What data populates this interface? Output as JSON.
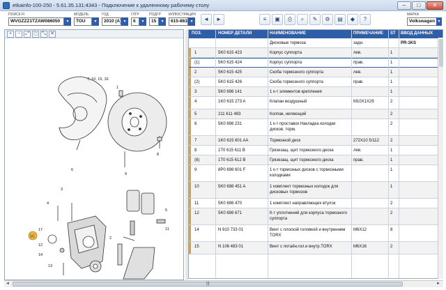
{
  "window": {
    "title": "etkainfo-100-250 - 5.61.35.131:4343 - Подключение к удаленному рабочему столу",
    "min": "–",
    "max": "□",
    "close": "✕"
  },
  "filters": {
    "vin": {
      "label": "ПОИСК FI",
      "value": "WVGZZZ1TZAW086050"
    },
    "model": {
      "label": "МОДЕЛЬ",
      "value": "TOU"
    },
    "year": {
      "label": "ГОД",
      "value": "2010 (A)"
    },
    "group": {
      "label": "ГЛГР",
      "value": "6"
    },
    "subgroup": {
      "label": "ПОДГР",
      "value": "15"
    },
    "illustration": {
      "label": "ИЛЛЮСТРАЦИЯ",
      "value": "615-863"
    },
    "brand": {
      "label": "МАРКА",
      "value": "Volkswagen"
    },
    "drop": "▾"
  },
  "toolbar": [
    "◄",
    "►",
    "≡",
    "▣",
    "⎙",
    "⌕",
    "✎",
    "⚙",
    "▤",
    "◆",
    "?"
  ],
  "zoom": [
    "+",
    "−",
    "⤢",
    "◻",
    "⤡",
    "✕"
  ],
  "diagram": {
    "callouts": [
      "7, 10, 15, 16",
      "1",
      "3",
      "17",
      "12",
      "14",
      "13",
      "1C",
      "2",
      "6",
      "4",
      "5",
      "8",
      "9",
      "11"
    ]
  },
  "table": {
    "headers": [
      "ПОЗ.",
      "НОМЕР ДЕТАЛИ",
      "НАИМЕНОВАНИЕ",
      "ПРИМЕЧАНИЕ",
      "ST",
      "ВВОД ДАННЫХ"
    ],
    "intro_name": "Дисковые тормоза",
    "intro_note": "задн.",
    "intro_data": "PR-1KS",
    "rows": [
      {
        "pos": "1",
        "part": "5K0 615 423",
        "name": "Корпус суппорта",
        "note": "лев.",
        "qty": "1"
      },
      {
        "pos": "(1)",
        "part": "5K0 615 424",
        "name": "Корпус суппорта",
        "note": "прав.",
        "qty": "1"
      },
      {
        "pos": "2",
        "part": "5K0 615 425",
        "name": "Скоба тормозного суппорта",
        "note": "лев.",
        "qty": "1"
      },
      {
        "pos": "(2)",
        "part": "5K0 615 426",
        "name": "Скоба тормозного суппорта",
        "note": "прав.",
        "qty": "1"
      },
      {
        "pos": "3",
        "part": "5K0 698 141",
        "name": "1 к-т элементов крепления",
        "note": "",
        "qty": "1"
      },
      {
        "pos": "4",
        "part": "1K0 615 273 A",
        "name": "Клапан воздушный",
        "note": "M10X1X29",
        "qty": "2"
      },
      {
        "pos": "5",
        "part": "211 611 483",
        "name": "Колпак, нелеющий",
        "note": "",
        "qty": "2"
      },
      {
        "pos": "6",
        "part": "5K0 698 231",
        "name": "1 к-т проставок Накладка колодки дисков. торм.",
        "note": "",
        "qty": "2"
      },
      {
        "pos": "7",
        "part": "1K0 615 601 AA",
        "name": "Тормозной диск",
        "note": "272X10  5/112",
        "qty": "2"
      },
      {
        "pos": "8",
        "part": "1T0 615 611 B",
        "name": "Грязезащ. щит тормозного диска",
        "note": "лев.",
        "qty": "1"
      },
      {
        "pos": "(8)",
        "part": "1T0 615 612 B",
        "name": "Грязезащ. щит тормозного диска",
        "note": "прав.",
        "qty": "1"
      },
      {
        "pos": "9",
        "part": "8P0 698 601 F",
        "name": "1 к-т тормозных дисков с тормозными колодками",
        "note": "",
        "qty": "1"
      },
      {
        "pos": "10",
        "part": "5K0 698 451 A",
        "name": "1 комплект тормозных колодок для дисковых тормозов",
        "note": "",
        "qty": "1"
      },
      {
        "pos": "11",
        "part": "5K0 698 470",
        "name": "1 комплект направляющих втулок",
        "note": "",
        "qty": "2"
      },
      {
        "pos": "12",
        "part": "5K0 698 671",
        "name": "К-т уплотнений для корпуса тормозного суппорта",
        "note": "",
        "qty": "2"
      },
      {
        "pos": "14",
        "part": "N   910 733 01",
        "name": "Винт с плоской головкой и внутренним TORX",
        "note": "M6X12",
        "qty": "8"
      },
      {
        "pos": "15",
        "part": "N   106 483 01",
        "name": "Винт с потайн.гол.и внутр.TORX",
        "note": "M6X16",
        "qty": "2"
      }
    ]
  },
  "scroll": {
    "left": "◄",
    "right": "►",
    "grip": "|||"
  }
}
